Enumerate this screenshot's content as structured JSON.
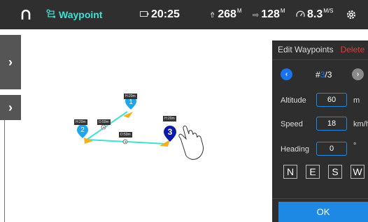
{
  "topbar": {
    "home_icon": "drone-home-icon",
    "mode_icon": "waypoint-path-icon",
    "mode_label": "Waypoint",
    "battery_icon": "battery-icon",
    "flight_time": "20:25",
    "altitude_icon": "altitude-icon",
    "altitude": "268",
    "altitude_unit": "M",
    "distance_icon": "distance-icon",
    "distance": "128",
    "distance_unit": "M",
    "speed_icon": "speedometer-icon",
    "speed": "8.3",
    "speed_unit": "M/S",
    "settings_icon": "gear-icon"
  },
  "map": {
    "waypoints": [
      {
        "number": "1",
        "height_label": "H:20m"
      },
      {
        "number": "2",
        "height_label": "H:20m"
      },
      {
        "number": "3",
        "height_label": "H:20m"
      }
    ],
    "segments": [
      {
        "distance_label": "D:50m"
      },
      {
        "distance_label": "D:50m"
      }
    ]
  },
  "panel": {
    "title": "Edit Waypoints",
    "delete_label": "Delete",
    "nav_prefix": "#",
    "current_waypoint": "3",
    "total_waypoints": "/3",
    "altitude_label": "Altitude",
    "altitude_value": "60",
    "altitude_unit": "m",
    "speed_label": "Speed",
    "speed_value": "18",
    "speed_unit": "km/h",
    "heading_label": "Heading",
    "heading_value": "0",
    "heading_unit": "°",
    "directions": [
      "N",
      "E",
      "S",
      "W"
    ],
    "ok_label": "OK"
  },
  "colors": {
    "accent": "#1e88e5",
    "mode_color": "#3fe1d2",
    "delete_color": "#e53935",
    "selected_waypoint": "#0d1aa8",
    "waypoint": "#1ea7ec",
    "path": "#3fe1d2",
    "heading_arrow": "#f2b01e"
  }
}
